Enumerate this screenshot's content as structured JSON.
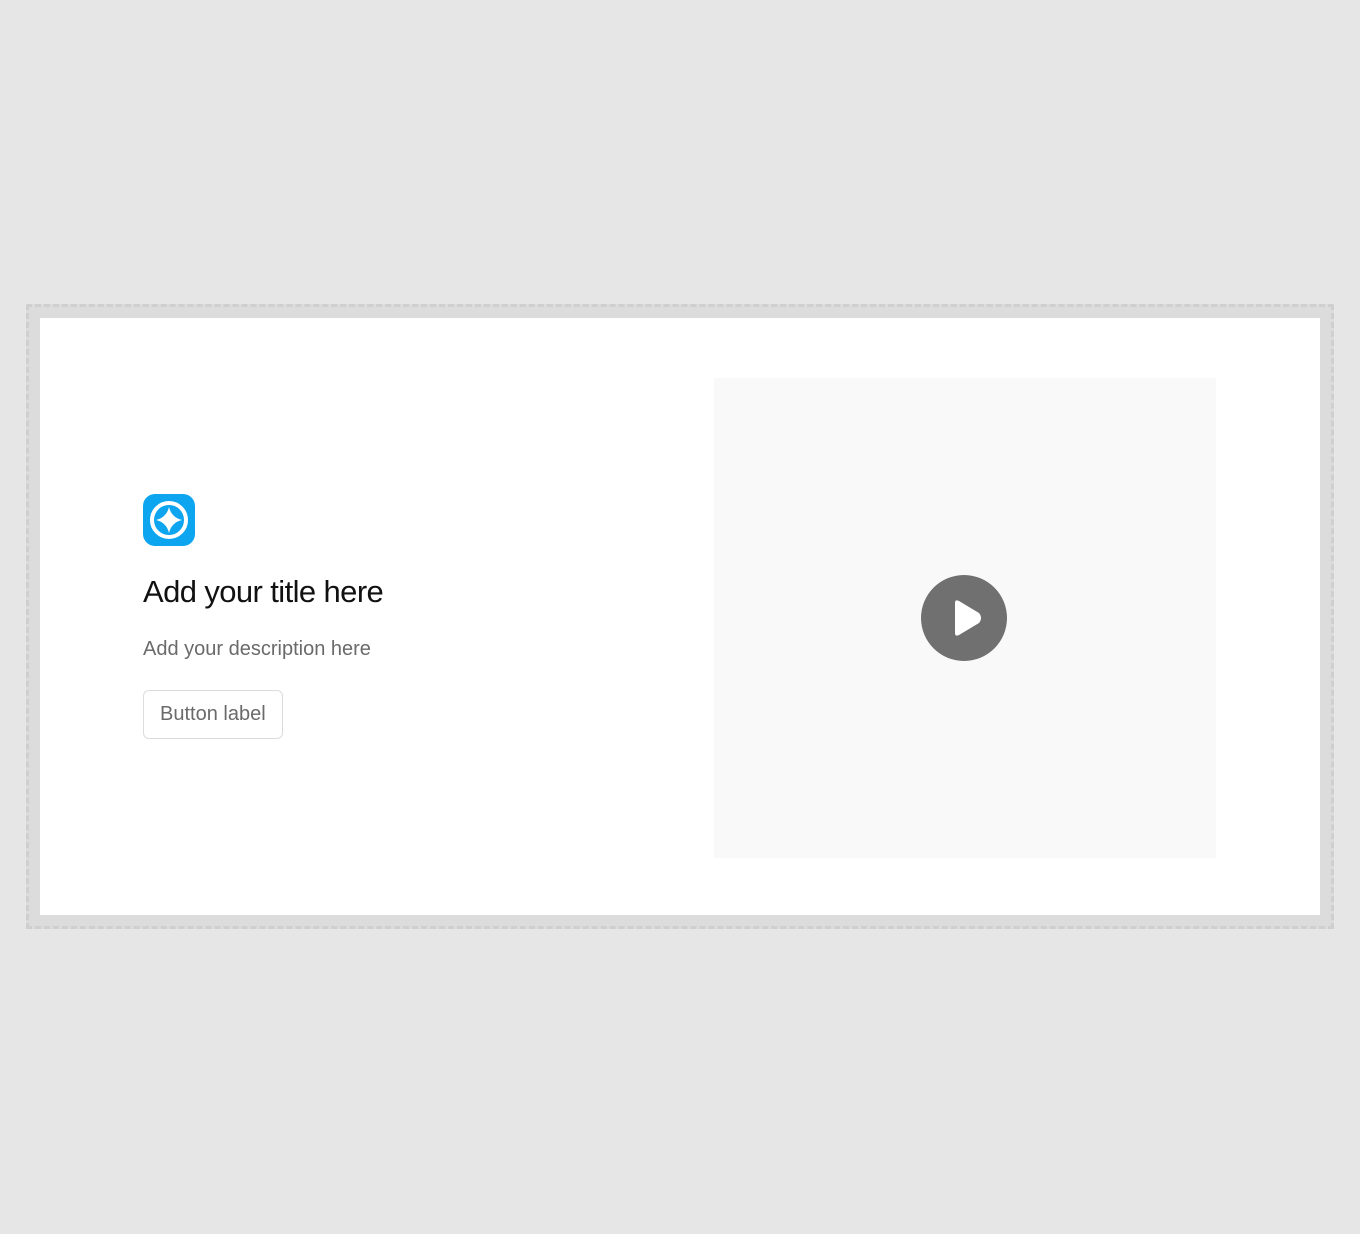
{
  "hero": {
    "title": "Add your title here",
    "description": "Add your description here",
    "button_label": "Button label",
    "logo_icon": "sparkle-star-icon",
    "accent_color": "#0ea5f0"
  },
  "media": {
    "play_icon": "play-icon",
    "play_color": "#707070"
  }
}
